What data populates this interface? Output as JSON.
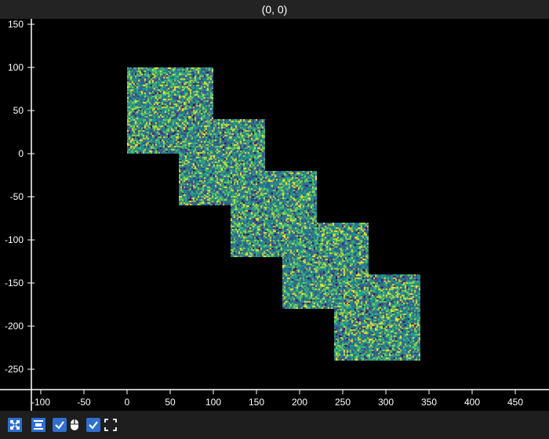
{
  "header": {
    "coordinate_readout": "(0, 0)"
  },
  "chart_data": {
    "type": "heatmap",
    "title": "",
    "xlabel": "",
    "ylabel": "",
    "xlim": [
      -115,
      470
    ],
    "ylim": [
      -272,
      156
    ],
    "x_ticks": [
      -100,
      -50,
      0,
      50,
      100,
      150,
      200,
      250,
      300,
      350,
      400,
      450
    ],
    "y_ticks": [
      150,
      100,
      50,
      0,
      -50,
      -100,
      -150,
      -200,
      -250
    ],
    "grid": false,
    "colormap": "viridis",
    "images": [
      {
        "x": [
          0,
          100
        ],
        "y": [
          0,
          100
        ]
      },
      {
        "x": [
          60,
          160
        ],
        "y": [
          -60,
          40
        ]
      },
      {
        "x": [
          120,
          220
        ],
        "y": [
          -120,
          -20
        ]
      },
      {
        "x": [
          180,
          280
        ],
        "y": [
          -180,
          -80
        ]
      },
      {
        "x": [
          240,
          340
        ],
        "y": [
          -240,
          -140
        ]
      }
    ]
  },
  "toolbar": {
    "buttons": [
      {
        "icon": "fit-all-icon"
      },
      {
        "icon": "align-center-icon"
      },
      {
        "icon": "checkbox-checked-icon"
      },
      {
        "icon": "mouse-icon"
      },
      {
        "icon": "checkbox-checked-icon"
      },
      {
        "icon": "fullscreen-icon"
      }
    ]
  },
  "colors": {
    "background": "#000000",
    "titlebar": "#232323",
    "toolbar": "#1e1e1e",
    "accent": "#2f6fd0"
  }
}
